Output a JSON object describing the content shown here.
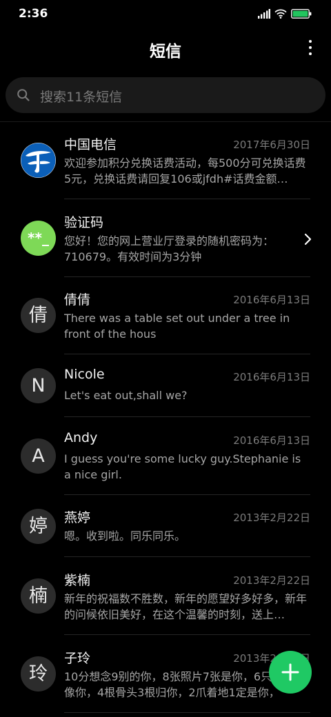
{
  "status_bar": {
    "time": "2:36",
    "signal_icon": "signal-icon",
    "wifi_icon": "wifi-icon",
    "battery_icon": "battery-icon",
    "battery_color": "#22c55e"
  },
  "header": {
    "title": "短信",
    "more_icon": "more-vertical-icon"
  },
  "search": {
    "placeholder": "搜索11条短信",
    "icon": "search-icon"
  },
  "messages": [
    {
      "sender": "中国电信",
      "date": "2017年6月30日",
      "preview": "欢迎参加积分兑换话费活动，每500分可兑换话费5元，兑换话费请回复106或jfdh#话费金额…",
      "avatar": "",
      "avatar_icon": "china-telecom-logo-icon"
    },
    {
      "sender": "验证码",
      "date": "",
      "preview": "您好！您的网上营业厅登录的随机密码为：710679。有效时间为3分钟",
      "avatar": "**_",
      "avatar_color": "#7ed957",
      "action_icon": "chevron-right-icon"
    },
    {
      "sender": "倩倩",
      "date": "2016年6月13日",
      "preview": "There was a table set out under a tree in front of the hous",
      "avatar": "倩"
    },
    {
      "sender": "Nicole",
      "date": "2016年6月13日",
      "preview": "Let's eat out,shall we?",
      "avatar": "N"
    },
    {
      "sender": "Andy",
      "date": "2016年6月13日",
      "preview": "I guess you're some lucky guy.Stephanie is a nice girl.",
      "avatar": "A"
    },
    {
      "sender": "燕婷",
      "date": "2013年2月22日",
      "preview": "嗯。收到啦。同乐同乐。",
      "avatar": "婷"
    },
    {
      "sender": "紫楠",
      "date": "2013年2月22日",
      "preview": "新年的祝福数不胜数，新年的愿望好多好多，新年的问候依旧美好，在这个温馨的时刻，送上…",
      "avatar": "楠"
    },
    {
      "sender": "子玲",
      "date": "2013年2月22日",
      "preview": "10分想念9别的你，8张照片7张是你，6只眼睛只像你，4根骨头3根归你，2爪着地1定是你，",
      "avatar": "玲"
    }
  ],
  "fab": {
    "icon": "plus-icon",
    "color": "#1fc964"
  }
}
